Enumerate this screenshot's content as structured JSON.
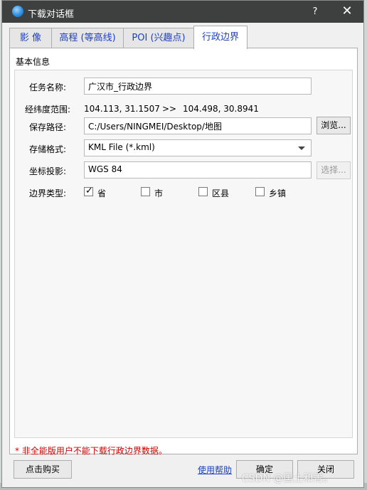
{
  "window": {
    "title": "下载对话框",
    "help_label": "?",
    "close_label": "✕",
    "app_icon": "globe-app-icon"
  },
  "tabs": [
    {
      "label": "影  像",
      "active": false
    },
    {
      "label": "高程 (等高线)",
      "active": false
    },
    {
      "label": "POI (兴趣点)",
      "active": false
    },
    {
      "label": "行政边界",
      "active": true
    }
  ],
  "basic_info": {
    "group_label": "基本信息",
    "task_name": {
      "label": "任务名称:",
      "value": "广汉市_行政边界"
    },
    "range": {
      "label": "经纬度范围:",
      "start": "104.113, 31.1507",
      "arrow": ">>",
      "end": "104.498, 30.8941"
    },
    "save_path": {
      "label": "保存路径:",
      "value": "C:/Users/NINGMEI/Desktop/地图",
      "browse_label": "浏览..."
    },
    "format": {
      "label": "存储格式:",
      "value": "KML File (*.kml)"
    },
    "projection": {
      "label": "坐标投影:",
      "value": "WGS 84",
      "select_label": "选择..."
    },
    "boundary": {
      "label": "边界类型:",
      "options": [
        {
          "label": "省",
          "checked": true
        },
        {
          "label": "市",
          "checked": false
        },
        {
          "label": "区县",
          "checked": false
        },
        {
          "label": "乡镇",
          "checked": false
        }
      ]
    }
  },
  "footer": {
    "warning": "* 非全能版用户不能下载行政边界数据。",
    "buy_label": "点击购买",
    "help_link": "使用帮助",
    "ok_label": "确定",
    "close_label": "关闭",
    "watermark": "CSDN @国土和箐。"
  }
}
